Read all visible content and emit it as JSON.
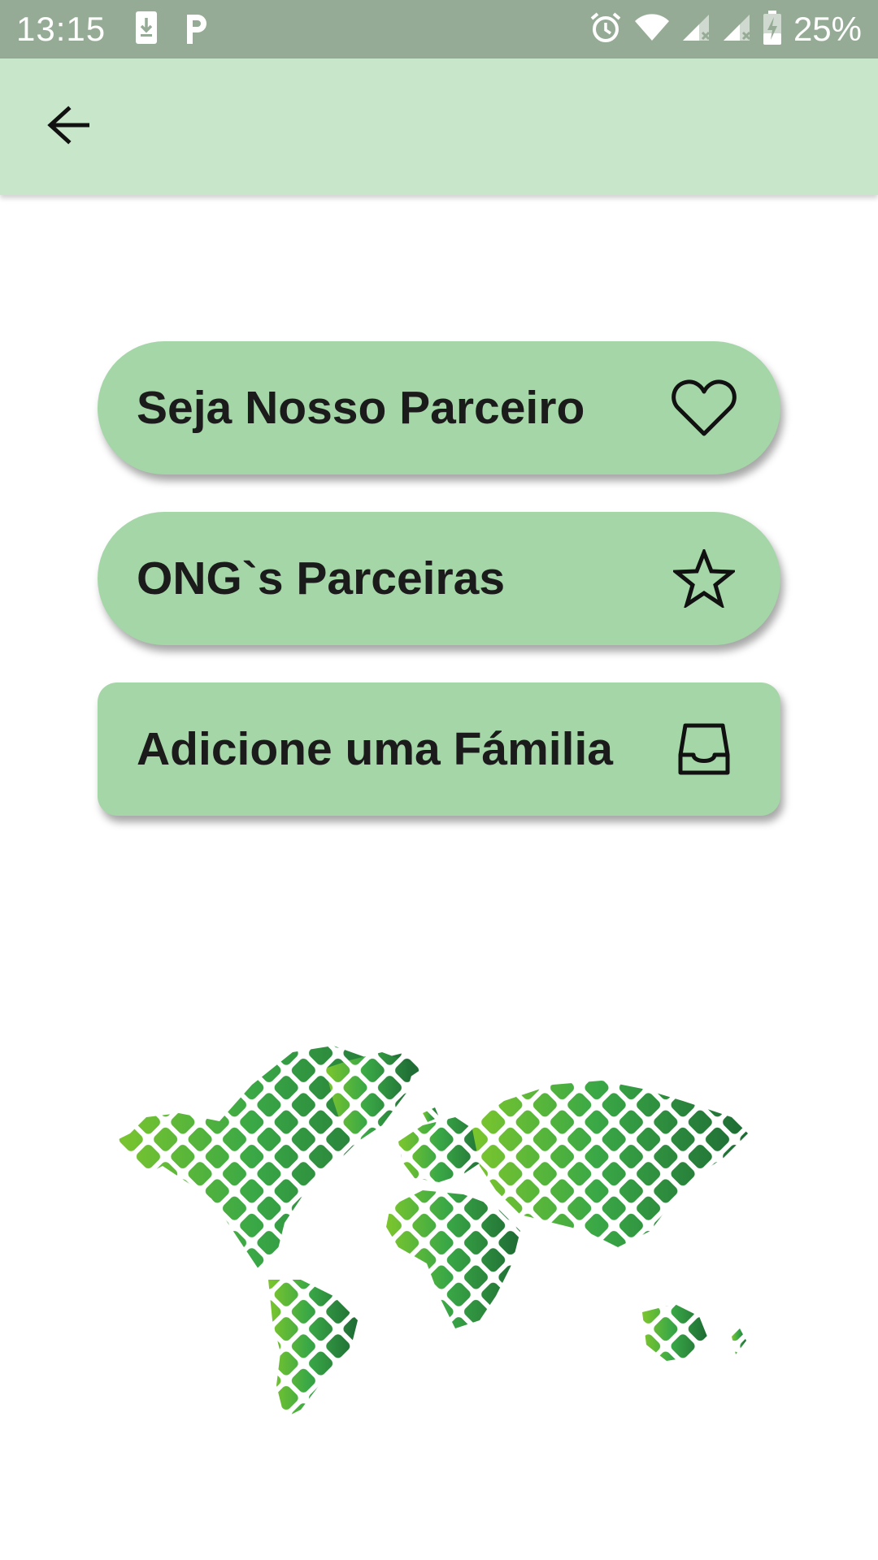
{
  "status_bar": {
    "time": "13:15",
    "battery_percent": "25%",
    "icons": [
      "download-icon",
      "parking-app-icon",
      "alarm-icon",
      "wifi-icon",
      "signal-icon",
      "signal-icon",
      "battery-charging-icon"
    ]
  },
  "app_bar": {
    "back_icon": "arrow-left-icon"
  },
  "menu": {
    "items": [
      {
        "label": "Seja Nosso Parceiro",
        "icon": "heart-icon"
      },
      {
        "label": "ONG`s Parceiras",
        "icon": "star-icon"
      },
      {
        "label": "Adicione uma Fámilia",
        "icon": "inbox-icon"
      }
    ]
  },
  "colors": {
    "status_bar": "#96ab96",
    "app_bar": "#c8e6c9",
    "button": "#a5d6a7",
    "map_light": "#7cc62d",
    "map_mid": "#3aa846",
    "map_dark": "#1e6b34"
  },
  "illustration": {
    "icon": "world-map-icon"
  }
}
